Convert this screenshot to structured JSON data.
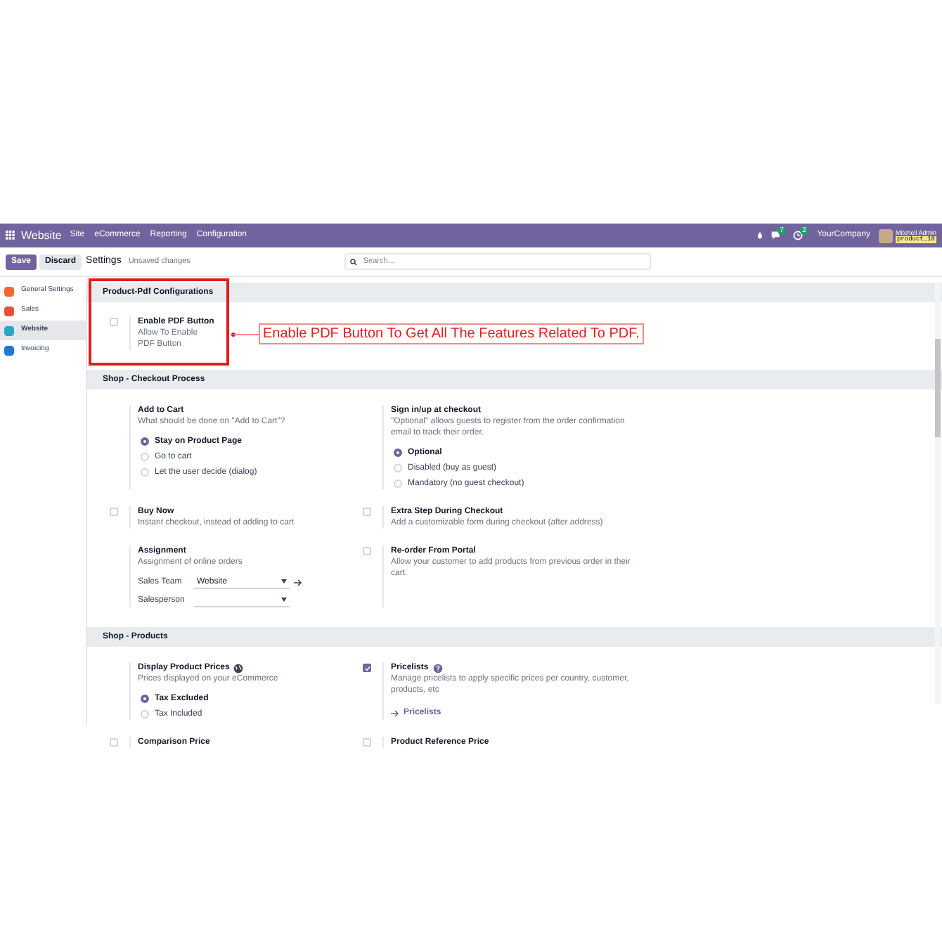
{
  "navbar": {
    "app_name": "Website",
    "menu": [
      "Site",
      "eCommerce",
      "Reporting",
      "Configuration"
    ],
    "message_count": "7",
    "activity_count": "2",
    "company": "YourCompany",
    "user_name": "Mitchell Admin",
    "database": "product_18"
  },
  "control_panel": {
    "save": "Save",
    "discard": "Discard",
    "breadcrumb": "Settings",
    "status": "Unsaved changes",
    "search": {
      "placeholder": "Search..."
    }
  },
  "sidebar": {
    "items": [
      {
        "label": "General Settings",
        "color": "#f06a2a",
        "selected": false
      },
      {
        "label": "Sales",
        "color": "#e8513c",
        "selected": false
      },
      {
        "label": "Website",
        "color": "#2ba4c8",
        "selected": true
      },
      {
        "label": "Invoicing",
        "color": "#1f7ad6",
        "selected": false
      }
    ]
  },
  "sections": [
    {
      "title": "Product-Pdf Configurations",
      "highlighted": true,
      "annotation": "Enable PDF Button To Get All The Features Related To PDF.",
      "settings": [
        {
          "kind": "checkbox",
          "checked": false,
          "title": "Enable PDF Button",
          "description": "Allow To Enable PDF Button"
        }
      ]
    },
    {
      "title": "Shop - Checkout Process",
      "highlighted": false,
      "settings": [
        {
          "kind": "radio",
          "title": "Add to Cart",
          "description": "What should be done on \"Add to Cart\"?",
          "options": [
            {
              "label": "Stay on Product Page",
              "selected": true
            },
            {
              "label": "Go to cart",
              "selected": false
            },
            {
              "label": "Let the user decide (dialog)",
              "selected": false
            }
          ]
        },
        {
          "kind": "radio",
          "title": "Sign in/up at checkout",
          "description": "\"Optional\" allows guests to register from the order confirmation email to track their order.",
          "options": [
            {
              "label": "Optional",
              "selected": true
            },
            {
              "label": "Disabled (buy as guest)",
              "selected": false
            },
            {
              "label": "Mandatory (no guest checkout)",
              "selected": false
            }
          ]
        },
        {
          "kind": "checkbox",
          "checked": false,
          "title": "Buy Now",
          "description": "Instant checkout, instead of adding to cart"
        },
        {
          "kind": "checkbox",
          "checked": false,
          "title": "Extra Step During Checkout",
          "description": "Add a customizable form during checkout (after address)"
        },
        {
          "kind": "fields",
          "title": "Assignment",
          "description": "Assignment of online orders",
          "fields": [
            {
              "label": "Sales Team",
              "value": "Website",
              "link": true
            },
            {
              "label": "Salesperson",
              "link": false
            }
          ]
        },
        {
          "kind": "checkbox",
          "checked": false,
          "title": "Re-order From Portal",
          "description": "Allow your customer to add products from previous order in their cart."
        }
      ]
    },
    {
      "title": "Shop - Products",
      "highlighted": false,
      "settings": [
        {
          "kind": "radio",
          "title": "Display Product Prices",
          "description": "Prices displayed on your eCommerce",
          "options": [
            {
              "label": "Tax Excluded",
              "selected": true
            },
            {
              "label": "Tax Included",
              "selected": false
            }
          ]
        },
        {
          "kind": "checkbox",
          "checked": true,
          "title": "Pricelists",
          "description": "Manage pricelists to apply specific prices per country, customer, products, etc",
          "link": "Pricelists"
        },
        {
          "kind": "checkbox",
          "checked": false,
          "title": "Comparison Price"
        },
        {
          "kind": "checkbox",
          "checked": false,
          "title": "Product Reference Price"
        }
      ]
    }
  ]
}
